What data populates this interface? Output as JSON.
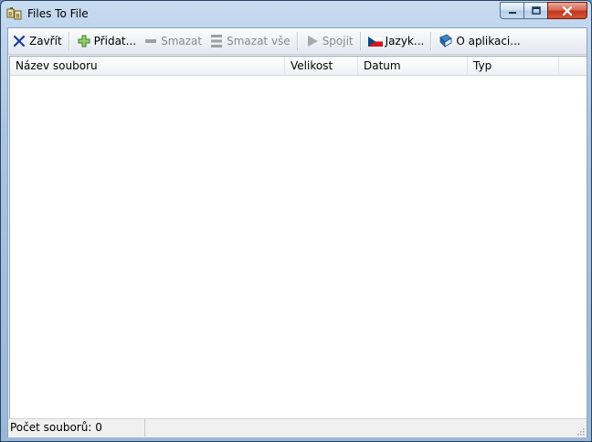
{
  "window": {
    "title": "Files To File"
  },
  "toolbar": {
    "close_label": "Zavřít",
    "add_label": "Přidat...",
    "remove_label": "Smazat",
    "remove_all_label": "Smazat vše",
    "join_label": "Spojit",
    "language_label": "Jazyk...",
    "about_label": "O aplikaci..."
  },
  "table": {
    "columns": [
      "Název souboru",
      "Velikost",
      "Datum",
      "Typ"
    ],
    "rows": []
  },
  "status": {
    "file_count": "Počet souborů: 0"
  },
  "colors": {
    "accent": "#1e3e9a",
    "add_icon": "#5aa33b",
    "disabled": "#8a8a8a"
  }
}
